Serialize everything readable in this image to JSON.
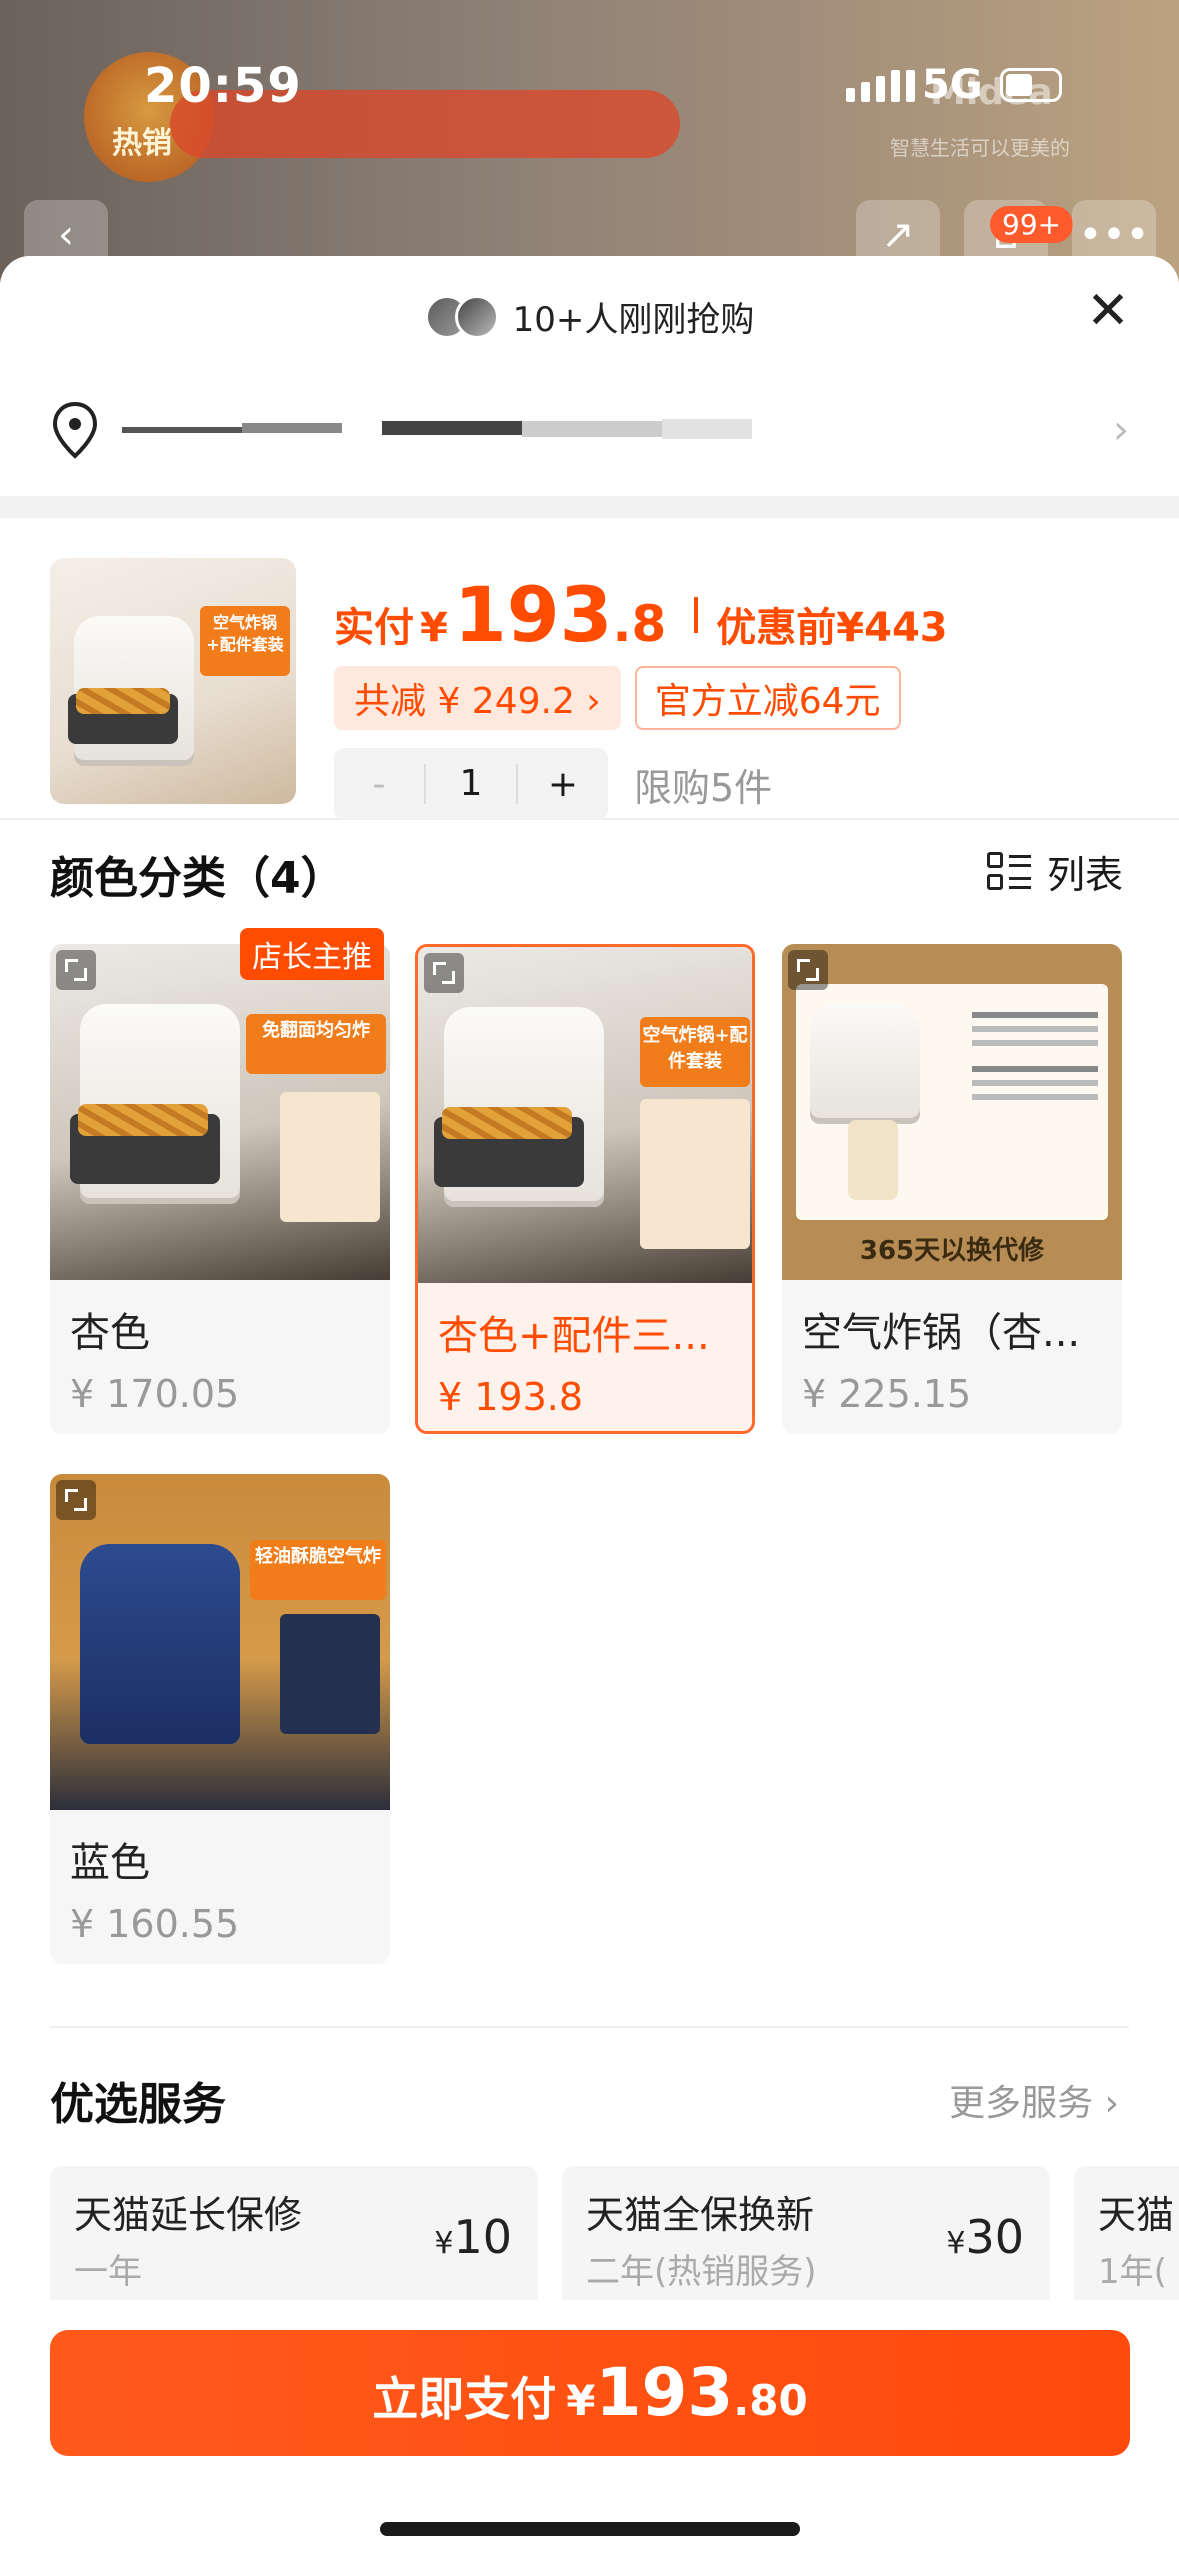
{
  "status_bar": {
    "time": "20:59",
    "network": "5G"
  },
  "background": {
    "badge_text": "热销",
    "brand": "Midea",
    "slogan": "智慧生活可以更美的",
    "cart_count": "99+"
  },
  "sheet": {
    "buyers_text": "10+人刚刚抢购",
    "close_label": "✕",
    "address_chevron": "›"
  },
  "product": {
    "price_label": "实付",
    "price_currency": "¥",
    "price_integer": "193",
    "price_decimal": ".8",
    "before_label": "优惠前",
    "before_price": "¥443",
    "discount_total": "共减 ¥ 249.2 ›",
    "official_discount": "官方立减64元",
    "qty_minus": "-",
    "qty_value": "1",
    "qty_plus": "+",
    "limit_text": "限购5件",
    "thumb_tag": "空气炸锅+配件套装"
  },
  "color_section": {
    "title": "颜色分类（4）",
    "list_toggle": "列表",
    "items": [
      {
        "name": "杏色",
        "price": "¥ 170.05",
        "badge": "店长主推",
        "tag": "免翻面均匀炸",
        "selected": false
      },
      {
        "name": "杏色+配件三...",
        "price": "¥ 193.8",
        "badge": "",
        "tag": "空气炸锅+配件套装",
        "selected": true
      },
      {
        "name": "空气炸锅（杏...",
        "price": "¥ 225.15",
        "badge": "",
        "tag": "365天以换代修",
        "selected": false
      },
      {
        "name": "蓝色",
        "price": "¥ 160.55",
        "badge": "",
        "tag": "轻油酥脆空气炸",
        "selected": false
      }
    ]
  },
  "service_section": {
    "title": "优选服务",
    "more": "更多服务 ›",
    "items": [
      {
        "name": "天猫延长保修",
        "sub": "一年",
        "currency": "¥",
        "price": "10"
      },
      {
        "name": "天猫全保换新",
        "sub": "二年(热销服务)",
        "currency": "¥",
        "price": "30"
      },
      {
        "name": "天猫",
        "sub": "1年(",
        "currency": "",
        "price": ""
      }
    ]
  },
  "pay": {
    "label": "立即支付",
    "currency": "¥",
    "integer": "193",
    "decimal": ".80"
  },
  "colors": {
    "accent": "#ff4c00",
    "accent_light": "#ffe9df",
    "selected_border": "#ff6a2a"
  }
}
